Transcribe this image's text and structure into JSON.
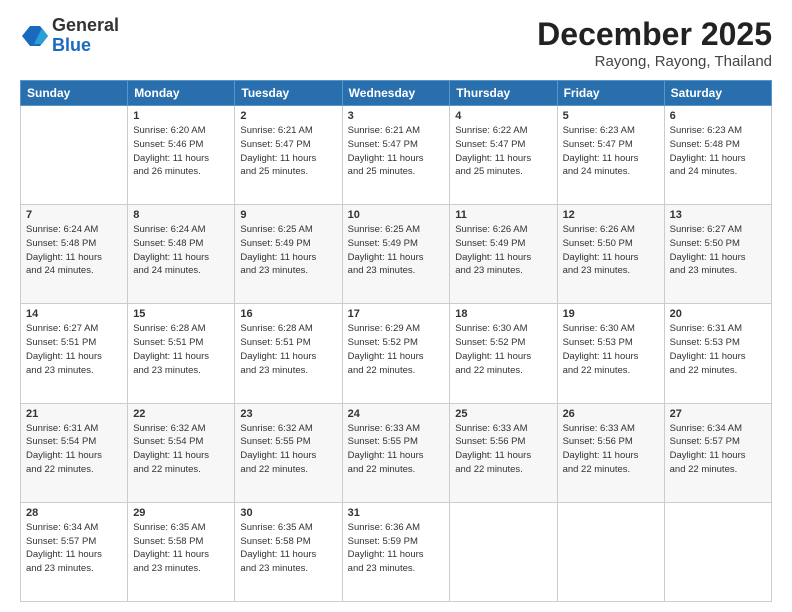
{
  "header": {
    "logo_general": "General",
    "logo_blue": "Blue",
    "month": "December 2025",
    "location": "Rayong, Rayong, Thailand"
  },
  "calendar": {
    "headers": [
      "Sunday",
      "Monday",
      "Tuesday",
      "Wednesday",
      "Thursday",
      "Friday",
      "Saturday"
    ],
    "weeks": [
      [
        {
          "day": "",
          "info": ""
        },
        {
          "day": "1",
          "info": "Sunrise: 6:20 AM\nSunset: 5:46 PM\nDaylight: 11 hours\nand 26 minutes."
        },
        {
          "day": "2",
          "info": "Sunrise: 6:21 AM\nSunset: 5:47 PM\nDaylight: 11 hours\nand 25 minutes."
        },
        {
          "day": "3",
          "info": "Sunrise: 6:21 AM\nSunset: 5:47 PM\nDaylight: 11 hours\nand 25 minutes."
        },
        {
          "day": "4",
          "info": "Sunrise: 6:22 AM\nSunset: 5:47 PM\nDaylight: 11 hours\nand 25 minutes."
        },
        {
          "day": "5",
          "info": "Sunrise: 6:23 AM\nSunset: 5:47 PM\nDaylight: 11 hours\nand 24 minutes."
        },
        {
          "day": "6",
          "info": "Sunrise: 6:23 AM\nSunset: 5:48 PM\nDaylight: 11 hours\nand 24 minutes."
        }
      ],
      [
        {
          "day": "7",
          "info": "Sunrise: 6:24 AM\nSunset: 5:48 PM\nDaylight: 11 hours\nand 24 minutes."
        },
        {
          "day": "8",
          "info": "Sunrise: 6:24 AM\nSunset: 5:48 PM\nDaylight: 11 hours\nand 24 minutes."
        },
        {
          "day": "9",
          "info": "Sunrise: 6:25 AM\nSunset: 5:49 PM\nDaylight: 11 hours\nand 23 minutes."
        },
        {
          "day": "10",
          "info": "Sunrise: 6:25 AM\nSunset: 5:49 PM\nDaylight: 11 hours\nand 23 minutes."
        },
        {
          "day": "11",
          "info": "Sunrise: 6:26 AM\nSunset: 5:49 PM\nDaylight: 11 hours\nand 23 minutes."
        },
        {
          "day": "12",
          "info": "Sunrise: 6:26 AM\nSunset: 5:50 PM\nDaylight: 11 hours\nand 23 minutes."
        },
        {
          "day": "13",
          "info": "Sunrise: 6:27 AM\nSunset: 5:50 PM\nDaylight: 11 hours\nand 23 minutes."
        }
      ],
      [
        {
          "day": "14",
          "info": "Sunrise: 6:27 AM\nSunset: 5:51 PM\nDaylight: 11 hours\nand 23 minutes."
        },
        {
          "day": "15",
          "info": "Sunrise: 6:28 AM\nSunset: 5:51 PM\nDaylight: 11 hours\nand 23 minutes."
        },
        {
          "day": "16",
          "info": "Sunrise: 6:28 AM\nSunset: 5:51 PM\nDaylight: 11 hours\nand 23 minutes."
        },
        {
          "day": "17",
          "info": "Sunrise: 6:29 AM\nSunset: 5:52 PM\nDaylight: 11 hours\nand 22 minutes."
        },
        {
          "day": "18",
          "info": "Sunrise: 6:30 AM\nSunset: 5:52 PM\nDaylight: 11 hours\nand 22 minutes."
        },
        {
          "day": "19",
          "info": "Sunrise: 6:30 AM\nSunset: 5:53 PM\nDaylight: 11 hours\nand 22 minutes."
        },
        {
          "day": "20",
          "info": "Sunrise: 6:31 AM\nSunset: 5:53 PM\nDaylight: 11 hours\nand 22 minutes."
        }
      ],
      [
        {
          "day": "21",
          "info": "Sunrise: 6:31 AM\nSunset: 5:54 PM\nDaylight: 11 hours\nand 22 minutes."
        },
        {
          "day": "22",
          "info": "Sunrise: 6:32 AM\nSunset: 5:54 PM\nDaylight: 11 hours\nand 22 minutes."
        },
        {
          "day": "23",
          "info": "Sunrise: 6:32 AM\nSunset: 5:55 PM\nDaylight: 11 hours\nand 22 minutes."
        },
        {
          "day": "24",
          "info": "Sunrise: 6:33 AM\nSunset: 5:55 PM\nDaylight: 11 hours\nand 22 minutes."
        },
        {
          "day": "25",
          "info": "Sunrise: 6:33 AM\nSunset: 5:56 PM\nDaylight: 11 hours\nand 22 minutes."
        },
        {
          "day": "26",
          "info": "Sunrise: 6:33 AM\nSunset: 5:56 PM\nDaylight: 11 hours\nand 22 minutes."
        },
        {
          "day": "27",
          "info": "Sunrise: 6:34 AM\nSunset: 5:57 PM\nDaylight: 11 hours\nand 22 minutes."
        }
      ],
      [
        {
          "day": "28",
          "info": "Sunrise: 6:34 AM\nSunset: 5:57 PM\nDaylight: 11 hours\nand 23 minutes."
        },
        {
          "day": "29",
          "info": "Sunrise: 6:35 AM\nSunset: 5:58 PM\nDaylight: 11 hours\nand 23 minutes."
        },
        {
          "day": "30",
          "info": "Sunrise: 6:35 AM\nSunset: 5:58 PM\nDaylight: 11 hours\nand 23 minutes."
        },
        {
          "day": "31",
          "info": "Sunrise: 6:36 AM\nSunset: 5:59 PM\nDaylight: 11 hours\nand 23 minutes."
        },
        {
          "day": "",
          "info": ""
        },
        {
          "day": "",
          "info": ""
        },
        {
          "day": "",
          "info": ""
        }
      ]
    ]
  }
}
